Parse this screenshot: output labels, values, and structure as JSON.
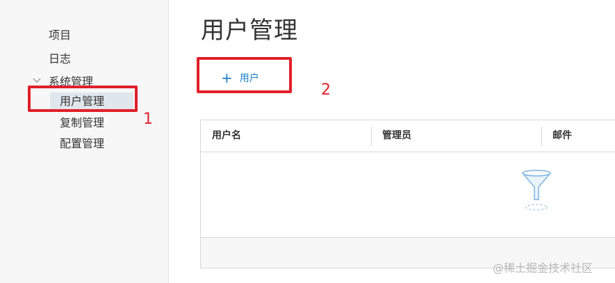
{
  "sidebar": {
    "items": [
      {
        "label": "项目"
      },
      {
        "label": "日志"
      }
    ],
    "group": {
      "label": "系统管理",
      "children": [
        {
          "label": "用户管理",
          "active": true
        },
        {
          "label": "复制管理"
        },
        {
          "label": "配置管理"
        }
      ]
    }
  },
  "page": {
    "title": "用户管理",
    "add_button_icon": "plus-icon",
    "add_button_label": "用户"
  },
  "table": {
    "columns": [
      "用户名",
      "管理员",
      "邮件"
    ],
    "rows": [],
    "empty_icon": "funnel-icon"
  },
  "annotations": {
    "one": "1",
    "two": "2",
    "color": "#e0202a"
  },
  "colors": {
    "accent": "#1a7dc4",
    "active_item_bg": "#dfe6ec"
  },
  "watermark": "@稀土掘金技术社区"
}
